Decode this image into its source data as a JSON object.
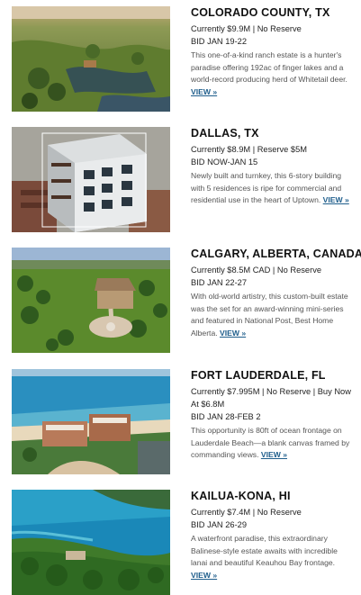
{
  "colors": {
    "link": "#1f5e8c",
    "heading": "#111111",
    "body_text": "#555555"
  },
  "listings": [
    {
      "location": "COLORADO COUNTY, TX",
      "price": "Currently $9.9M | No Reserve",
      "bid": "BID JAN 19-22",
      "description": "This one-of-a-kind ranch estate is a hunter's paradise offering 192ac of finger lakes and a world-record producing herd of Whitetail deer.",
      "view_label": "VIEW »",
      "photo_icon": "ranch-aerial-photo"
    },
    {
      "location": "DALLAS, TX",
      "price": "Currently $8.9M | Reserve $5M",
      "bid": "BID NOW-JAN 15",
      "description": "Newly built and turnkey, this 6-story building with 5 residences is ripe for commercial and residential use in the heart of Uptown.",
      "view_label": "VIEW »",
      "photo_icon": "building-aerial-photo"
    },
    {
      "location": "CALGARY, ALBERTA, CANADA",
      "price": "Currently $8.5M CAD | No Reserve",
      "bid": "BID JAN 22-27",
      "description": "With old-world artistry, this custom-built estate was the set for an award-winning mini-series and featured in National Post, Best Home Alberta.",
      "view_label": "VIEW »",
      "photo_icon": "estate-aerial-photo"
    },
    {
      "location": "FORT LAUDERDALE, FL",
      "price": "Currently $7.995M | No Reserve | Buy Now At $6.8M",
      "bid": "BID JAN 28-FEB 2",
      "description": "This opportunity is 80ft of ocean frontage on Lauderdale Beach—a blank canvas framed by commanding views.",
      "view_label": "VIEW »",
      "photo_icon": "beach-aerial-photo"
    },
    {
      "location": "KAILUA-KONA, HI",
      "price": "Currently $7.4M | No Reserve",
      "bid": "BID JAN 26-29",
      "description": "A waterfront paradise, this extraordinary Balinese-style estate awaits with incredible lanai and beautiful Keauhou Bay frontage.",
      "view_label": "VIEW »",
      "photo_icon": "bay-aerial-photo"
    }
  ]
}
